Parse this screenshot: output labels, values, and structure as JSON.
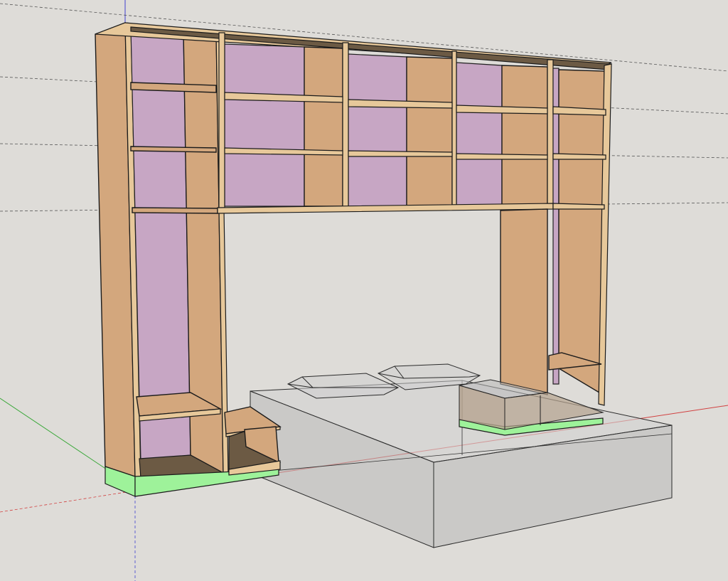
{
  "scene": {
    "canvas_background": "#dedcd8",
    "colors": {
      "wood_side": "#d3a77d",
      "wood_edge": "#e7c89a",
      "wood_shadow": "#6c5a44",
      "back_panel": "#c7a6c4",
      "plinth": "#9ef29a",
      "bed_glass": "#b9b9b9",
      "axis_red": "#d14040",
      "axis_green": "#3aa83a",
      "axis_blue": "#4040d0",
      "guide_line": "#555555"
    },
    "objects": {
      "bookcase_bridge": "bookcase-bridge",
      "left_tower": "left-tower",
      "right_tower": "right-tower",
      "step_box": "step-box",
      "bed": "bed",
      "pillows": [
        "pillow-left",
        "pillow-right"
      ],
      "nightstand": "nightstand"
    }
  }
}
